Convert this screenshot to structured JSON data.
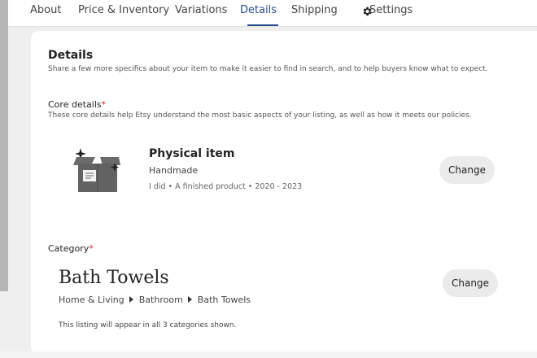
{
  "nav": {
    "tabs": [
      {
        "label": "About"
      },
      {
        "label": "Price & Inventory"
      },
      {
        "label": "Variations"
      },
      {
        "label": "Details"
      },
      {
        "label": "Shipping"
      },
      {
        "label": "Settings"
      }
    ],
    "active_tab": "Details",
    "settings_icon": "gear-icon"
  },
  "details": {
    "title": "Details",
    "subtitle": "Share a few more specifics about your item to make it easier to find in search, and to help buyers know what to expect."
  },
  "core_details": {
    "title": "Core details",
    "required_mark": "*",
    "description": "These core details help Etsy understand the most basic aspects of your listing, as well as how it meets our policies.",
    "item_icon": "box-sparkle-icon",
    "item_title": "Physical item",
    "item_subtitle": "Handmade",
    "item_meta": "I did • A finished product • 2020 - 2023",
    "change_label": "Change"
  },
  "category": {
    "title": "Category",
    "required_mark": "*",
    "name": "Bath Towels",
    "breadcrumb": [
      "Home & Living",
      "Bathroom",
      "Bath Towels"
    ],
    "note": "This listing will appear in all 3 categories shown.",
    "change_label": "Change"
  },
  "colors": {
    "active_tab": "#2a4d8f",
    "required": "#c2262e",
    "button_bg": "#ebebeb"
  }
}
